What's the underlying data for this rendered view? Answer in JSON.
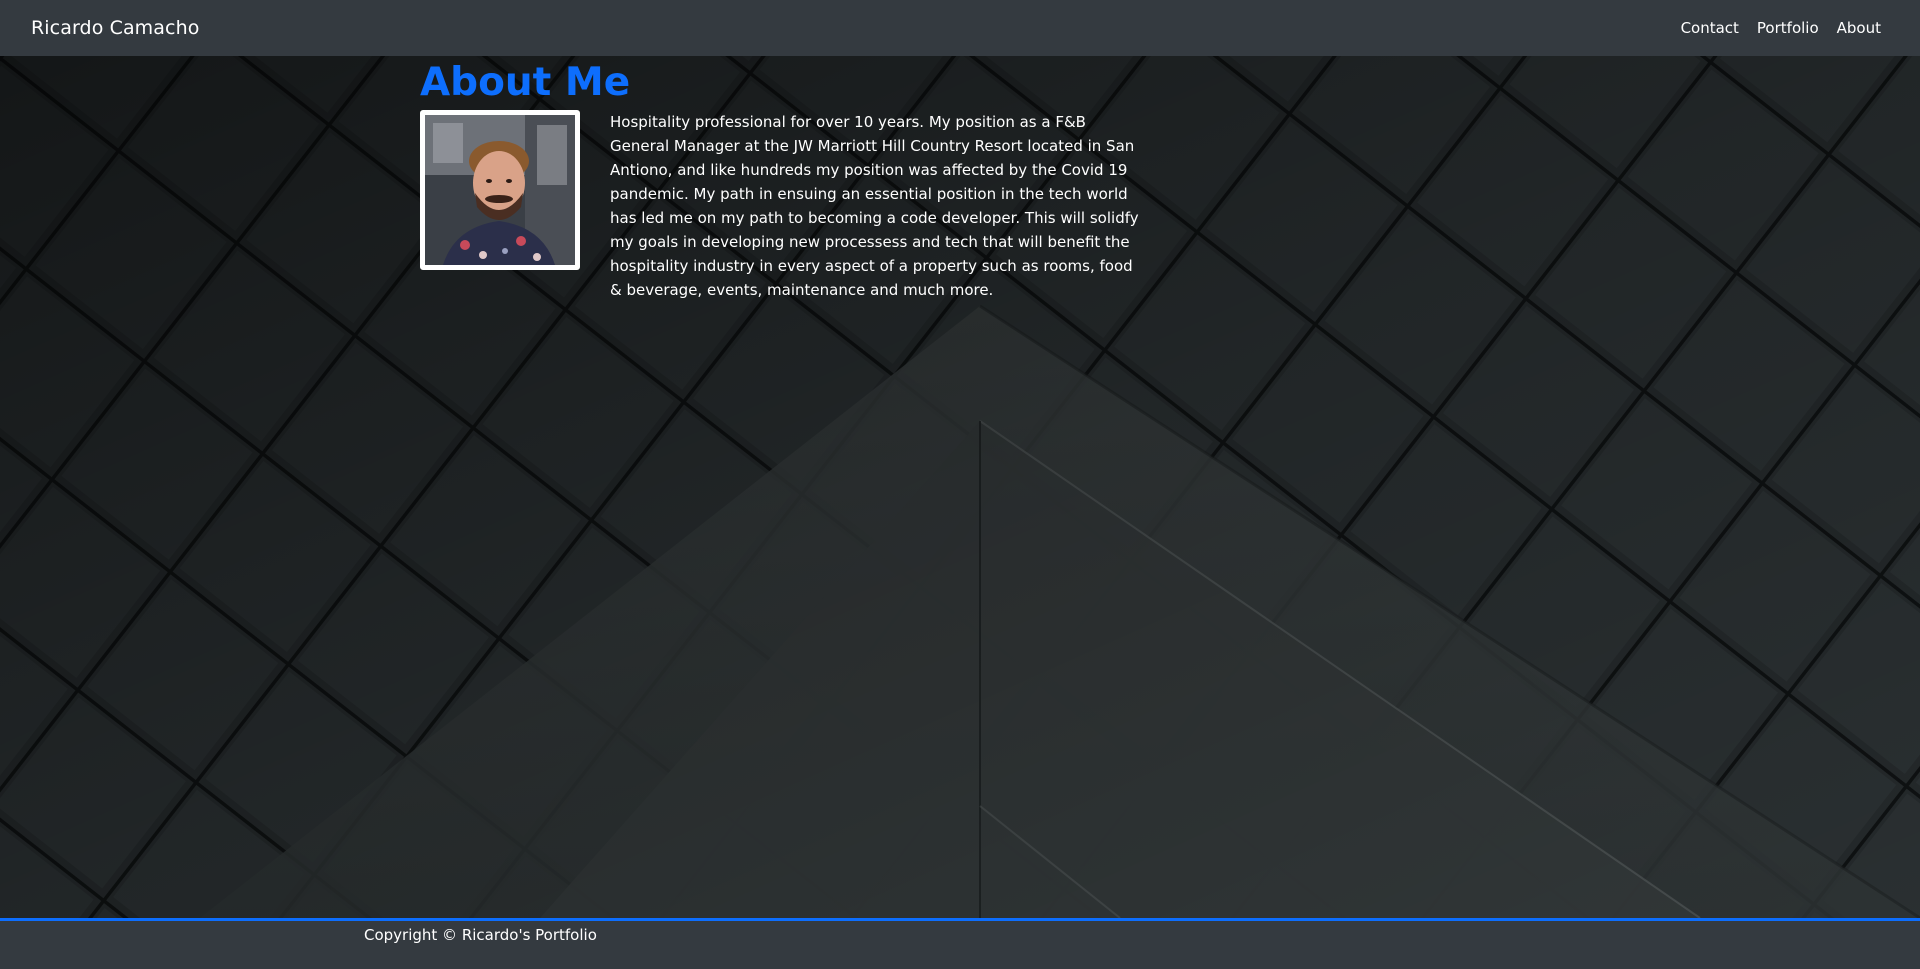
{
  "navbar": {
    "brand": "Ricardo Camacho",
    "links": [
      "Contact",
      "Portfolio",
      "About"
    ]
  },
  "about": {
    "title": "About Me",
    "avatar_icon": "profile-photo",
    "text": "Hospitality professional for over 10 years. My position as a F&B General Manager at the JW Marriott Hill Country Resort located in San Antiono, and like hundreds my position was affected by the Covid 19 pandemic. My path in ensuing an essential position in the tech world has led me on my path to becoming a code developer. This will solidfy my goals in developing new processess and tech that will benefit the hospitality industry in every aspect of a property such as rooms, food & beverage, events, maintenance and much more."
  },
  "footer": {
    "copyright": "Copyright © Ricardo's Portfolio"
  },
  "colors": {
    "navbar_bg": "#343a40",
    "accent": "#0d6efd",
    "text": "#ffffff"
  }
}
